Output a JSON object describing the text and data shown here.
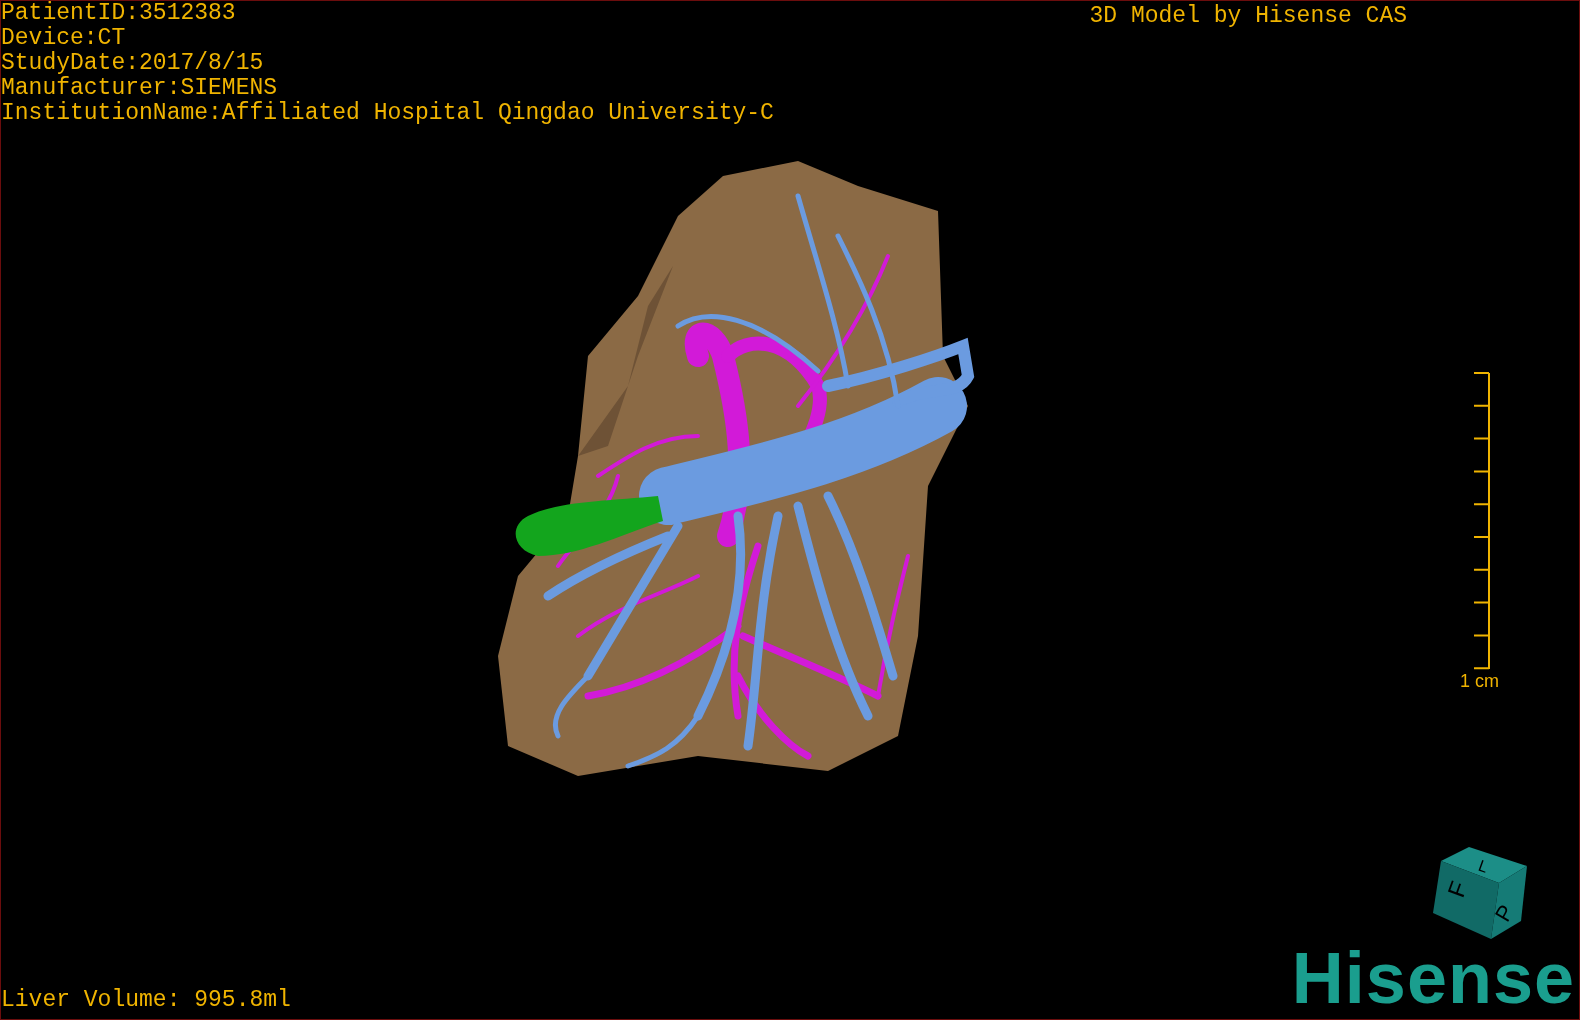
{
  "patient_info": [
    "PatientID:3512383",
    "Device:CT",
    "StudyDate:2017/8/15",
    "Manufacturer:SIEMENS",
    "InstitutionName:Affiliated Hospital Qingdao University-C"
  ],
  "model_credit": "3D Model by Hisense CAS",
  "scale_bar": {
    "label": "1 cm"
  },
  "orientation_cube": {
    "faces": [
      "F",
      "L",
      "P"
    ]
  },
  "liver_volume": "Liver Volume: 995.8ml",
  "logo": "Hisense"
}
